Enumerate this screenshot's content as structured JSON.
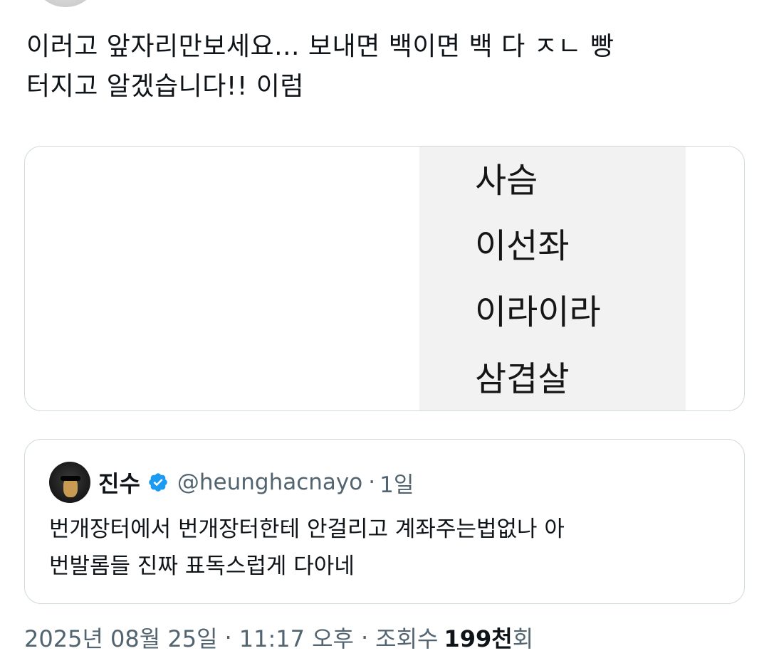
{
  "tweet": {
    "text_line1": "이러고 앞자리만보세요... 보내면 백이면 백 다 ㅈㄴ 빵",
    "text_line2": "터지고 알겠습니다!! 이럼"
  },
  "media": {
    "words": [
      "사슴",
      "이선좌",
      "이라이라",
      "삼겹살"
    ]
  },
  "quote": {
    "name": "진수",
    "handle": "@heunghacnayo",
    "separator": "·",
    "time": "1일",
    "text_line1": "번개장터에서 번개장터한테 안걸리고 계좌주는법없나 아",
    "text_line2": "번발롬들 진짜 표독스럽게 다아네",
    "verified_color": "#1d9bf0"
  },
  "meta": {
    "date": "2025년 08월 25일",
    "sep1": "·",
    "time": "11:17 오후",
    "sep2": "·",
    "views_label": "조회수",
    "views_number": "199천",
    "views_suffix": "회"
  },
  "colors": {
    "text_primary": "#0f1419",
    "text_secondary": "#536471",
    "border": "#cfd9de",
    "media_panel": "#f2f2f2"
  }
}
